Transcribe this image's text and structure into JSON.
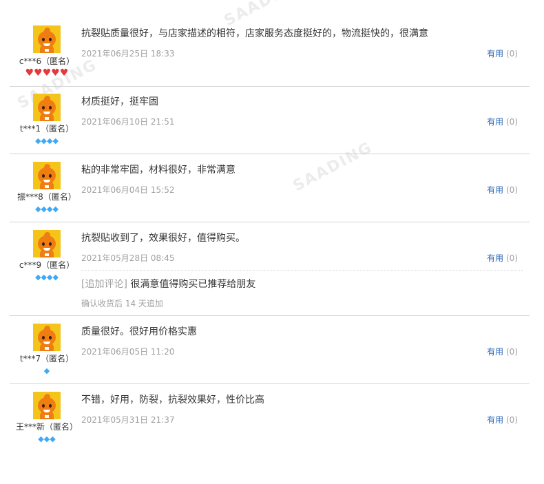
{
  "watermark": "SAADING",
  "useful_label": "有用",
  "append_tag": "[追加评论]",
  "reviews": [
    {
      "user": "c***6（匿名）",
      "badge_type": "heart",
      "badge_count": 5,
      "badge_icons": "♥♥♥♥♥",
      "content": "抗裂贴质量很好，与店家描述的相符，店家服务态度挺好的，物流挺快的，很满意",
      "date": "2021年06月25日 18:33",
      "useful_count": "(0)"
    },
    {
      "user": "t***1（匿名）",
      "badge_type": "diamond",
      "badge_count": 4,
      "badge_icons": "◆◆◆◆",
      "content": "材质挺好，挺牢固",
      "date": "2021年06月10日 21:51",
      "useful_count": "(0)"
    },
    {
      "user": "振***8（匿名）",
      "badge_type": "diamond",
      "badge_count": 4,
      "badge_icons": "◆◆◆◆",
      "content": "粘的非常牢固，材料很好，非常满意",
      "date": "2021年06月04日 15:52",
      "useful_count": "(0)"
    },
    {
      "user": "c***9（匿名）",
      "badge_type": "diamond",
      "badge_count": 4,
      "badge_icons": "◆◆◆◆",
      "content": "抗裂贴收到了，效果很好，值得购买。",
      "date": "2021年05月28日 08:45",
      "useful_count": "(0)",
      "append_content": "很满意值得购买已推荐给朋友",
      "append_note": "确认收货后 14 天追加"
    },
    {
      "user": "t***7（匿名）",
      "badge_type": "diamond",
      "badge_count": 1,
      "badge_icons": "◆",
      "content": "质量很好。很好用价格实惠",
      "date": "2021年06月05日 11:20",
      "useful_count": "(0)"
    },
    {
      "user": "王***新（匿名）",
      "badge_type": "diamond",
      "badge_count": 3,
      "badge_icons": "◆◆◆",
      "content": "不错，好用，防裂，抗裂效果好，性价比高",
      "date": "2021年05月31日 21:37",
      "useful_count": "(0)"
    }
  ]
}
